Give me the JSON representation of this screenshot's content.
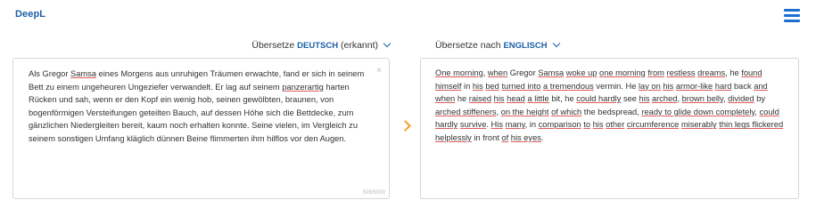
{
  "app": {
    "logo": "DeepL",
    "menu_icon": "hamburger-menu-icon"
  },
  "source": {
    "prefix": "Übersetze ",
    "lang": "DEUTSCH",
    "suffix": " (erkannt)",
    "text_parts": [
      "Als Gregor ",
      "Samsa",
      " eines Morgens aus unruhigen Träumen erwachte, fand er sich in seinem Bett zu einem ungeheuren Ungeziefer verwandelt. Er lag auf seinem ",
      "panzerartig",
      " harten Rücken und sah, wenn er den Kopf ein wenig hob, seinen gewölbten, braunen, von bogenförmigen Versteifungen geteilten Bauch, auf dessen Höhe sich die Bettdecke, zum gänzlichen Niedergleiten bereit, kaum noch erhalten konnte. Seine vielen, im Vergleich zu seinem sonstigen Umfang kläglich dünnen Beine flimmerten ihm hilflos vor den Augen."
    ],
    "clear_label": "×",
    "char_count": "508/5000"
  },
  "target": {
    "prefix": "Übersetze nach ",
    "lang": "ENGLISCH",
    "text_parts": [
      "One morning",
      ", ",
      "when",
      " Gregor ",
      "Samsa",
      " ",
      "woke up",
      " ",
      "one morning",
      " ",
      "from",
      " ",
      "restless",
      " ",
      "dreams",
      ", he ",
      "found himself",
      " in ",
      "his",
      " ",
      "bed",
      " ",
      "turned into",
      " ",
      "a tremendous",
      " vermin. He ",
      "lay on",
      " ",
      "his",
      " ",
      "armor-like",
      " ",
      "hard",
      " back ",
      "and when",
      " he ",
      "raised",
      " ",
      "his",
      " ",
      "head",
      " ",
      "a little",
      " bit, he ",
      "could hardly",
      " see ",
      "his",
      " ",
      "arched",
      ", ",
      "brown belly",
      ", ",
      "divided",
      " by ",
      "arched stiffeners",
      ", ",
      "on the height",
      " ",
      "of which",
      " the bedspread, ",
      "ready to glide down completely",
      ", ",
      "could hardly",
      " ",
      "survive",
      ". ",
      "His",
      " ",
      "many",
      ", in ",
      "comparison",
      " ",
      "to",
      " ",
      "his",
      " ",
      "other",
      " ",
      "circumference",
      " ",
      "miserably",
      " ",
      "thin legs flickered",
      " ",
      "helplessly",
      " in front ",
      "of",
      " ",
      "his eyes",
      "."
    ]
  },
  "colors": {
    "brand": "#1b5fa8",
    "accent": "#f2a024",
    "underline": "#e05a5a"
  },
  "arrow_icon": "chevron-right-icon"
}
